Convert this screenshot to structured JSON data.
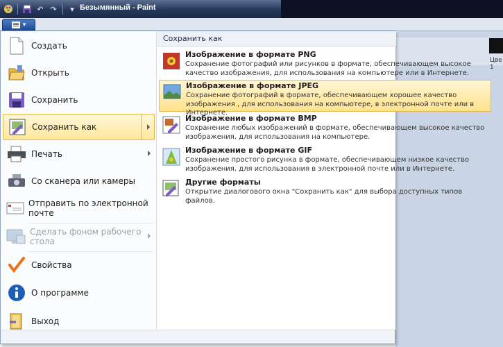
{
  "window": {
    "title": "Безымянный - Paint"
  },
  "background": {
    "cell_text": "Цве\n1"
  },
  "menu": {
    "items": [
      {
        "label": "Создать",
        "icon": "new-document-icon"
      },
      {
        "label": "Открыть",
        "icon": "open-folder-icon"
      },
      {
        "label": "Сохранить",
        "icon": "save-disk-icon"
      },
      {
        "label": "Сохранить как",
        "icon": "save-as-icon"
      },
      {
        "label": "Печать",
        "icon": "printer-icon"
      },
      {
        "label": "Со сканера или камеры",
        "icon": "scanner-icon"
      },
      {
        "label": "Отправить по электронной почте",
        "icon": "email-icon"
      },
      {
        "label": "Сделать фоном рабочего стола",
        "icon": "desktop-background-icon"
      },
      {
        "label": "Свойства",
        "icon": "checkmark-icon"
      },
      {
        "label": "О программе",
        "icon": "info-icon"
      },
      {
        "label": "Выход",
        "icon": "exit-icon"
      }
    ]
  },
  "save_as": {
    "header": "Сохранить как",
    "formats": [
      {
        "title": "Изображение в формате PNG",
        "desc": "Сохранение фотографий или рисунков в формате, обеспечивающем высокое качество изображения, для использования на компьютере или в Интернете."
      },
      {
        "title": "Изображение в формате JPEG",
        "desc": "Сохранение фотографий в формате, обеспечивающем хорошее качество изображения , для использования на компьютере, в электронной почте или в Интернете."
      },
      {
        "title": "Изображение в формате BMP",
        "desc": "Сохранение любых изображений в формате, обеспечивающем высокое качество изображения, для использования на компьютере."
      },
      {
        "title": "Изображение в формате GIF",
        "desc": "Сохранение простого рисунка в формате, обеспечивающем низкое качество изображения, для использования в электронной почте или в Интернете."
      },
      {
        "title": "Другие форматы",
        "desc": "Открытие диалогового окна \"Сохранить как\" для выбора доступных типов файлов."
      }
    ]
  },
  "colors": {
    "hover_bg": "#ffe79a",
    "hover_border": "#e2b94f",
    "titlebar": "#26365a"
  }
}
